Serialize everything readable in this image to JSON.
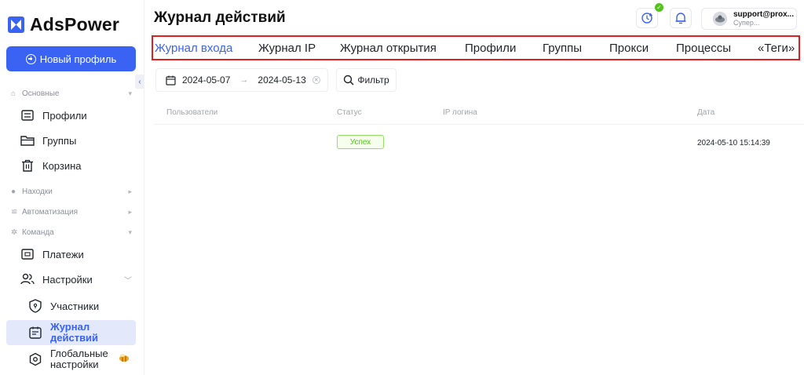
{
  "app": {
    "logo_text": "AdsPower",
    "new_profile_label": "Новый профиль"
  },
  "sidebar": {
    "section_main": "Основные",
    "items_main": [
      {
        "label": "Профили",
        "icon": "profile-list-icon"
      },
      {
        "label": "Группы",
        "icon": "folder-icon"
      },
      {
        "label": "Корзина",
        "icon": "trash-icon"
      }
    ],
    "section_finds": "Находки",
    "section_automation": "Автоматизация",
    "section_team": "Команда",
    "item_payments": "Платежи",
    "item_settings": "Настройки",
    "sub_members": "Участники",
    "sub_action_log_line1": "Журнал",
    "sub_action_log_line2": "действий",
    "sub_global_line1": "Глобальные",
    "sub_global_line2": "настройки"
  },
  "header": {
    "title": "Журнал действий",
    "user_email": "support@prox...",
    "user_role": "Супер..."
  },
  "tabs": [
    {
      "label": "Журнал входа",
      "active": true
    },
    {
      "label": "Журнал IP",
      "active": false
    },
    {
      "label": "Журнал открытия",
      "active": false
    },
    {
      "label": "Профили",
      "active": false
    },
    {
      "label": "Группы",
      "active": false
    },
    {
      "label": "Прокси",
      "active": false
    },
    {
      "label": "Процессы",
      "active": false
    },
    {
      "label": "«Теги»",
      "active": false
    }
  ],
  "filters": {
    "date_from": "2024-05-07",
    "date_to": "2024-05-13",
    "filter_label": "Фильтр"
  },
  "table": {
    "columns": [
      "Пользователи",
      "Статус",
      "IP логина",
      "Дата"
    ],
    "rows": [
      {
        "user": "",
        "status": "Успех",
        "ip": "",
        "date": "2024-05-10 15:14:39"
      }
    ]
  },
  "colors": {
    "accent": "#3b63f3",
    "highlight_border": "#e02020",
    "success": "#52c41a"
  }
}
